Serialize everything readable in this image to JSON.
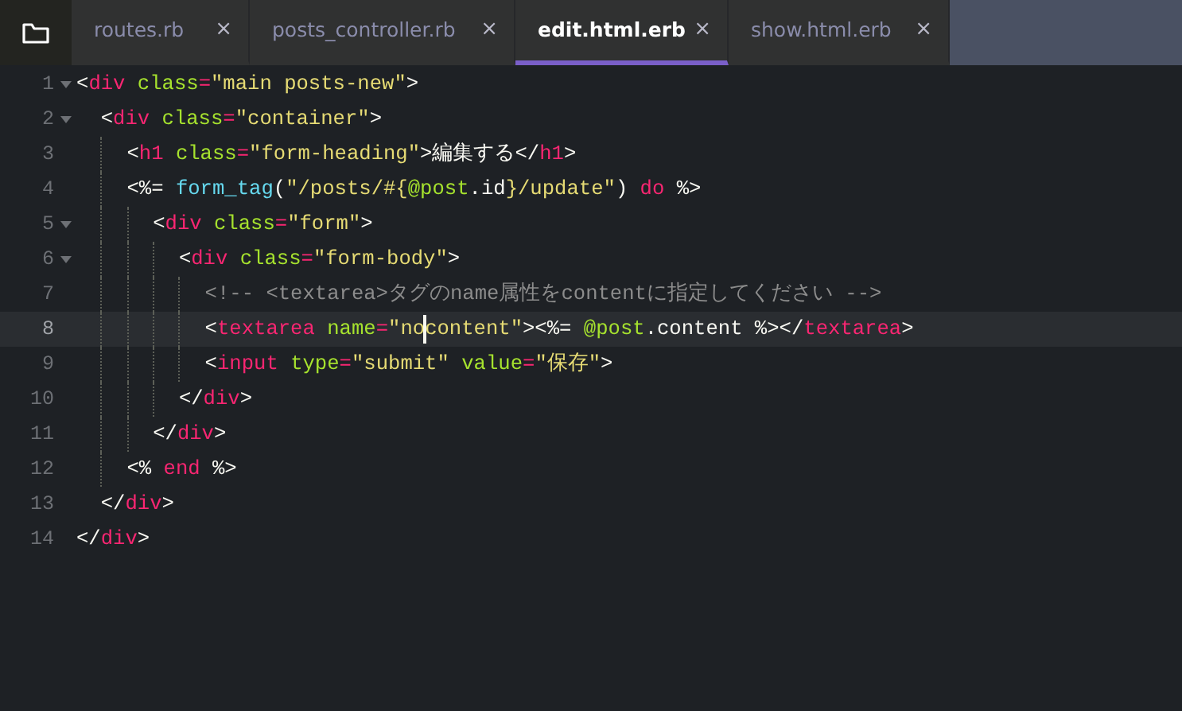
{
  "tabs": [
    {
      "label": "routes.rb",
      "close": "×",
      "selected": false
    },
    {
      "label": "posts_controller.rb",
      "close": "×",
      "selected": false
    },
    {
      "label": "edit.html.erb",
      "close": "×",
      "selected": true
    },
    {
      "label": "show.html.erb",
      "close": "×",
      "selected": false
    }
  ],
  "editor": {
    "lines": [
      {
        "number": "1",
        "foldable": true,
        "current": false,
        "tokens": [
          {
            "kind": "punct",
            "text": "<"
          },
          {
            "kind": "tag",
            "text": "div"
          },
          {
            "kind": "attr",
            "text": " class"
          },
          {
            "kind": "tag",
            "text": "="
          },
          {
            "kind": "string",
            "text": "\"main posts-new\""
          },
          {
            "kind": "punct",
            "text": ">"
          }
        ]
      },
      {
        "number": "2",
        "foldable": true,
        "current": false,
        "tokens": [
          {
            "kind": "punct",
            "text": "  <"
          },
          {
            "kind": "tag",
            "text": "div"
          },
          {
            "kind": "attr",
            "text": " class"
          },
          {
            "kind": "tag",
            "text": "="
          },
          {
            "kind": "string",
            "text": "\"container\""
          },
          {
            "kind": "punct",
            "text": ">"
          }
        ]
      },
      {
        "number": "3",
        "foldable": false,
        "current": false,
        "tokens": [
          {
            "kind": "punct",
            "text": "    <"
          },
          {
            "kind": "tag",
            "text": "h1"
          },
          {
            "kind": "attr",
            "text": " class"
          },
          {
            "kind": "tag",
            "text": "="
          },
          {
            "kind": "string",
            "text": "\"form-heading\""
          },
          {
            "kind": "punct",
            "text": ">編集する</"
          },
          {
            "kind": "tag",
            "text": "h1"
          },
          {
            "kind": "punct",
            "text": ">"
          }
        ]
      },
      {
        "number": "4",
        "foldable": false,
        "current": false,
        "tokens": [
          {
            "kind": "punct",
            "text": "    <%= "
          },
          {
            "kind": "function",
            "text": "form_tag"
          },
          {
            "kind": "punct",
            "text": "("
          },
          {
            "kind": "string",
            "text": "\"/posts/#{"
          },
          {
            "kind": "attr",
            "text": "@post"
          },
          {
            "kind": "punct",
            "text": ".id"
          },
          {
            "kind": "string",
            "text": "}/update\""
          },
          {
            "kind": "punct",
            "text": ") "
          },
          {
            "kind": "tag",
            "text": "do"
          },
          {
            "kind": "punct",
            "text": " %>"
          }
        ]
      },
      {
        "number": "5",
        "foldable": true,
        "current": false,
        "tokens": [
          {
            "kind": "punct",
            "text": "      <"
          },
          {
            "kind": "tag",
            "text": "div"
          },
          {
            "kind": "attr",
            "text": " class"
          },
          {
            "kind": "tag",
            "text": "="
          },
          {
            "kind": "string",
            "text": "\"form\""
          },
          {
            "kind": "punct",
            "text": ">"
          }
        ]
      },
      {
        "number": "6",
        "foldable": true,
        "current": false,
        "tokens": [
          {
            "kind": "punct",
            "text": "        <"
          },
          {
            "kind": "tag",
            "text": "div"
          },
          {
            "kind": "attr",
            "text": " class"
          },
          {
            "kind": "tag",
            "text": "="
          },
          {
            "kind": "string",
            "text": "\"form-body\""
          },
          {
            "kind": "punct",
            "text": ">"
          }
        ]
      },
      {
        "number": "7",
        "foldable": false,
        "current": false,
        "tokens": [
          {
            "kind": "comment",
            "text": "          <!-- <textarea>タグのname属性をcontentに指定してください -->"
          }
        ]
      },
      {
        "number": "8",
        "foldable": false,
        "current": true,
        "tokens": [
          {
            "kind": "punct",
            "text": "          <"
          },
          {
            "kind": "tag",
            "text": "textarea"
          },
          {
            "kind": "attr",
            "text": " name"
          },
          {
            "kind": "tag",
            "text": "="
          },
          {
            "kind": "string",
            "text": "\"no",
            "caret_after": true
          },
          {
            "kind": "string",
            "text": "content\""
          },
          {
            "kind": "punct",
            "text": "><%= "
          },
          {
            "kind": "attr",
            "text": "@post"
          },
          {
            "kind": "punct",
            "text": ".content %></"
          },
          {
            "kind": "tag",
            "text": "textarea"
          },
          {
            "kind": "punct",
            "text": ">"
          }
        ]
      },
      {
        "number": "9",
        "foldable": false,
        "current": false,
        "tokens": [
          {
            "kind": "punct",
            "text": "          <"
          },
          {
            "kind": "tag",
            "text": "input"
          },
          {
            "kind": "attr",
            "text": " type"
          },
          {
            "kind": "tag",
            "text": "="
          },
          {
            "kind": "string",
            "text": "\"submit\""
          },
          {
            "kind": "attr",
            "text": " value"
          },
          {
            "kind": "tag",
            "text": "="
          },
          {
            "kind": "string",
            "text": "\"保存\""
          },
          {
            "kind": "punct",
            "text": ">"
          }
        ]
      },
      {
        "number": "10",
        "foldable": false,
        "current": false,
        "tokens": [
          {
            "kind": "punct",
            "text": "        </"
          },
          {
            "kind": "tag",
            "text": "div"
          },
          {
            "kind": "punct",
            "text": ">"
          }
        ]
      },
      {
        "number": "11",
        "foldable": false,
        "current": false,
        "tokens": [
          {
            "kind": "punct",
            "text": "      </"
          },
          {
            "kind": "tag",
            "text": "div"
          },
          {
            "kind": "punct",
            "text": ">"
          }
        ]
      },
      {
        "number": "12",
        "foldable": false,
        "current": false,
        "tokens": [
          {
            "kind": "punct",
            "text": "    <% "
          },
          {
            "kind": "tag",
            "text": "end"
          },
          {
            "kind": "punct",
            "text": " %>"
          }
        ]
      },
      {
        "number": "13",
        "foldable": false,
        "current": false,
        "tokens": [
          {
            "kind": "punct",
            "text": "  </"
          },
          {
            "kind": "tag",
            "text": "div"
          },
          {
            "kind": "punct",
            "text": ">"
          }
        ]
      },
      {
        "number": "14",
        "foldable": false,
        "current": false,
        "tokens": [
          {
            "kind": "punct",
            "text": "</"
          },
          {
            "kind": "tag",
            "text": "div"
          },
          {
            "kind": "punct",
            "text": ">"
          }
        ]
      }
    ]
  }
}
